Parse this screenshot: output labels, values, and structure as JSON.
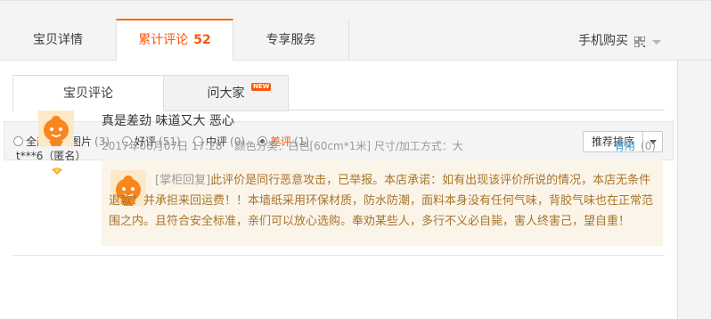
{
  "top_tabs": {
    "details": "宝贝详情",
    "reviews_label": "累计评论",
    "reviews_count": "52",
    "service": "专享服务",
    "mobile_buy": "手机购买"
  },
  "sub_tabs": {
    "reviews": "宝贝评论",
    "ask": "问大家",
    "new_badge": "NEW"
  },
  "filters": [
    {
      "label": "全部",
      "count": ""
    },
    {
      "label": "图片",
      "count": "(3)"
    },
    {
      "label": "好评",
      "count": "(51)"
    },
    {
      "label": "中评",
      "count": "(0)"
    },
    {
      "label": "差评",
      "count": "(1)"
    }
  ],
  "selected_filter": "差评",
  "sort_label": "推荐排序",
  "review": {
    "user": "t***6（匿名）",
    "content": "真是差劲 味道又大 恶心",
    "date": "2017年08月07日 17:28",
    "sku": "颜色分类：白色[60cm*1米]  尺寸/加工方式：大",
    "useful_label": "有用",
    "useful_count": "(0)",
    "reply_tag": "[掌柜回复]",
    "reply_text": "此评价是同行恶意攻击，已举报。本店承诺：如有出现该评价所说的情况，本店无条件退款！并承担来回运费！！本墙纸采用环保材质，防水防潮，面料本身没有任何气味，背胶气味也在正常范围之内。且符合安全标准，亲们可以放心选购。奉劝某些人，多行不义必自毙，害人终害己，望自重！"
  },
  "colors": {
    "accent": "#ff5500",
    "reply_bg": "#fbf4e9",
    "reply_text": "#a8752a",
    "link": "#3399cc"
  }
}
